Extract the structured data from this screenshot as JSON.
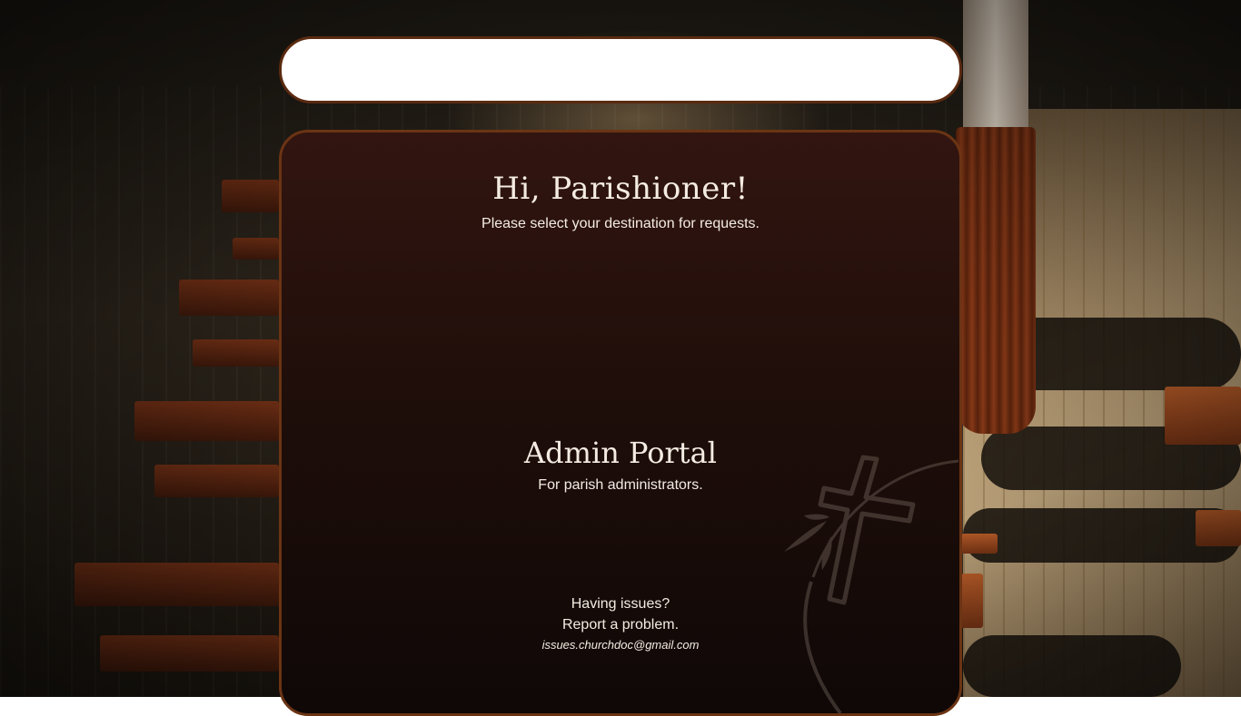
{
  "header": {
    "bar_text": ""
  },
  "card": {
    "greeting": "Hi, Parishioner!",
    "subtitle": "Please select your destination for requests.",
    "admin": {
      "title": "Admin Portal",
      "description": "For parish administrators."
    },
    "support": {
      "line1": "Having issues?",
      "line2": "Report a problem.",
      "email": "issues.churchdoc@gmail.com"
    }
  },
  "colors": {
    "card_top": "#321510",
    "card_bottom": "#0f0807",
    "card_border": "#6b3414",
    "text": "#f4ece2"
  },
  "icons": {
    "decoration": "cross-icon"
  }
}
